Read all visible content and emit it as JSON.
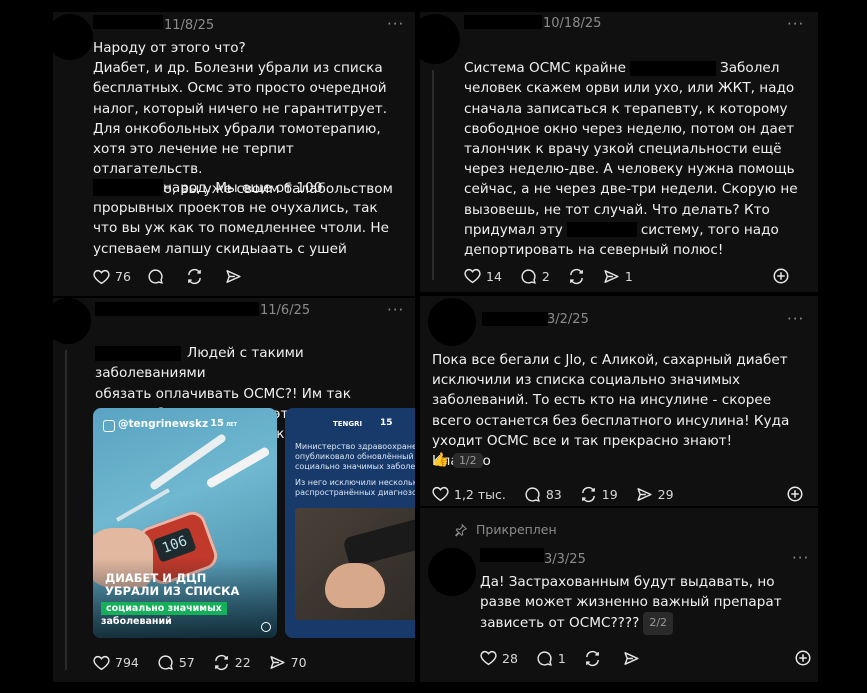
{
  "colors": {
    "page_bg": "#000000",
    "panel_bg": "#101010",
    "muted": "#8b8b8b",
    "accent_green": "#14b15a"
  },
  "posts": [
    {
      "date": "11/8/25",
      "text": "Народу от этого что?\nДиабет, и др. Болезни убрали из списка бесплатных. Осмс это просто очередной налог, который ничего не гарантитрует. Для онкобольных убрали томотерапию, хотя это лечение не терпит отлагательств.\nВот честно, вы уже своим балабольством",
      "text_2": "народ. Мы еще от 100 прорывных проектов не очухались, так что вы уж как то помедленнее чтоли. Не успеваем лапшу скидыаать с ушей",
      "likes": "76"
    },
    {
      "date": "10/18/25",
      "text_a": "Система ОСМС крайне",
      "text_b": "Заболел",
      "text_c": "человек скажем орви или ухо, или ЖКТ, надо сначала записаться к терапевту, к которому свободное окно через неделю, потом он дает талончик к врачу узкой специальности ещё через неделю-две. А человеку нужна помощь сейчас, а не через две-три недели. Скорую не вызовешь, не тот случай. Что делать? Кто",
      "text_d": "придумал эту",
      "text_e": "систему, того надо депортировать на северный полюс!",
      "likes": "14",
      "replies": "2",
      "shares": "1"
    },
    {
      "date": "11/6/25",
      "text_a": "Людей с такими заболеваниями",
      "text_b": "обязать оплачивать ОСМС?! Им так хочется больше денег в этом неэффективном фонде - кормушке?!",
      "likes": "794",
      "replies": "57",
      "reposts": "22",
      "shares": "70",
      "image1": {
        "handle": "@tengrinewskz",
        "badge": "15",
        "badge_suffix": "ЛЕТ",
        "headline_1": "ДИАБЕТ И ДЦП",
        "headline_2": "УБРАЛИ ИЗ СПИСКА",
        "tag": "социально значимых",
        "tag_2": "заболеваний",
        "meter": "106"
      },
      "image2": {
        "logo": "TENGRI",
        "badge": "15",
        "para_1": "Министерство здравоохранени опубликовало обновлённый сп социально значимых заболева",
        "para_2": "Из него исключили несколько распространённых диагнозов."
      }
    },
    {
      "date": "3/2/25",
      "text": "Пока все бегали с Jlo, с Аликой, сахарный диабет исключили из списка социально значимых заболеваний. То есть кто на инсулине - скорее всего останется без бесплатного инсулина!  Куда уходит ОСМС все и так прекрасно знают! Классно",
      "emoji": "👍",
      "pager": "1/2",
      "likes": "1,2 тыс.",
      "replies": "83",
      "reposts": "19",
      "shares": "29"
    },
    {
      "pinned_label": "Прикреплен",
      "date": "3/3/25",
      "text": "Да! Застрахованным будут выдавать, но разве может жизненно важный препарат зависеть от ОСМС????",
      "pager": "2/2",
      "likes": "28",
      "replies": "1"
    }
  ]
}
